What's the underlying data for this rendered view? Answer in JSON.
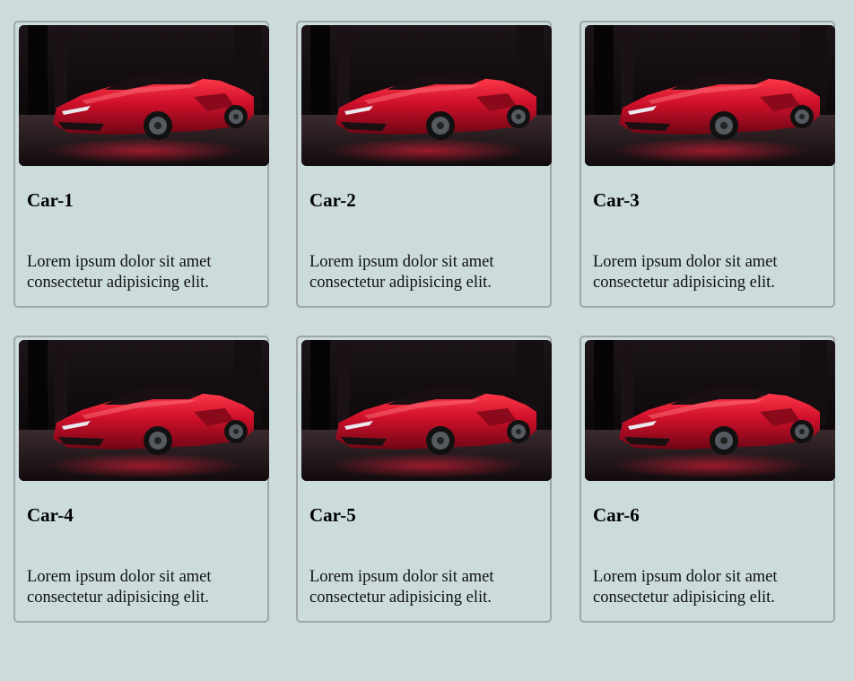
{
  "cards": [
    {
      "title": "Car-1",
      "image": "red-sports-car-image",
      "text": "Lorem ipsum dolor sit amet consectetur adipisicing elit."
    },
    {
      "title": "Car-2",
      "image": "red-sports-car-image",
      "text": "Lorem ipsum dolor sit amet consectetur adipisicing elit."
    },
    {
      "title": "Car-3",
      "image": "red-sports-car-image",
      "text": "Lorem ipsum dolor sit amet consectetur adipisicing elit."
    },
    {
      "title": "Car-4",
      "image": "red-sports-car-image",
      "text": "Lorem ipsum dolor sit amet consectetur adipisicing elit."
    },
    {
      "title": "Car-5",
      "image": "red-sports-car-image",
      "text": "Lorem ipsum dolor sit amet consectetur adipisicing elit."
    },
    {
      "title": "Car-6",
      "image": "red-sports-car-image",
      "text": "Lorem ipsum dolor sit amet consectetur adipisicing elit."
    }
  ],
  "colors": {
    "background": "#ccdbdc",
    "card_border": "#9fa6a8",
    "car_body": "#c8102e"
  }
}
